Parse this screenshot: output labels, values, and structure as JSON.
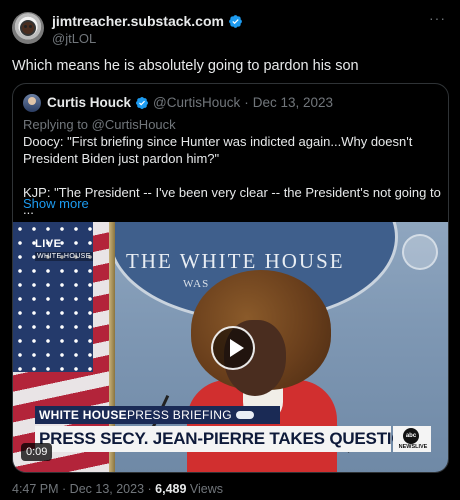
{
  "tweet": {
    "display_name": "jimtreacher.substack.com",
    "handle": "@jtLOL",
    "more_icon": "more-horizontal-icon",
    "text": "Which means he is absolutely going to pardon his son"
  },
  "quote": {
    "display_name": "Curtis Houck",
    "handle": "@CurtisHouck",
    "separator": "·",
    "date": "Dec 13, 2023",
    "replying_prefix": "Replying to ",
    "replying_to": "@CurtisHouck",
    "body_line1": "Doocy: \"First briefing since Hunter was indicted again...Why doesn't President Biden just pardon him?\"",
    "body_line2": "KJP: \"The President -- I've been very clear -- the President's not going to ...",
    "show_more": "Show more",
    "video": {
      "live": "LIVE",
      "live_sub": "WHITE HOUSE",
      "backdrop_text": "THE WHITE HOUSE",
      "backdrop_sub": "WAS",
      "lower_third_top_a": "WHITE HOUSE",
      "lower_third_top_b": " PRESS BRIEFING",
      "lower_third_main": "PRESS SECY. JEAN-PIERRE TAKES QUESTIONS",
      "network_logo": "abc",
      "network_sub": "NEWSLIVE",
      "duration": "0:09"
    }
  },
  "footer": {
    "time": "4:47 PM",
    "separator": " · ",
    "date": "Dec 13, 2023",
    "views_count": "6,489",
    "views_label": " Views"
  },
  "colors": {
    "background": "#000000",
    "text": "#e7e9ea",
    "muted": "#71767b",
    "accent": "#1d9bf0",
    "border": "#2f3336"
  }
}
